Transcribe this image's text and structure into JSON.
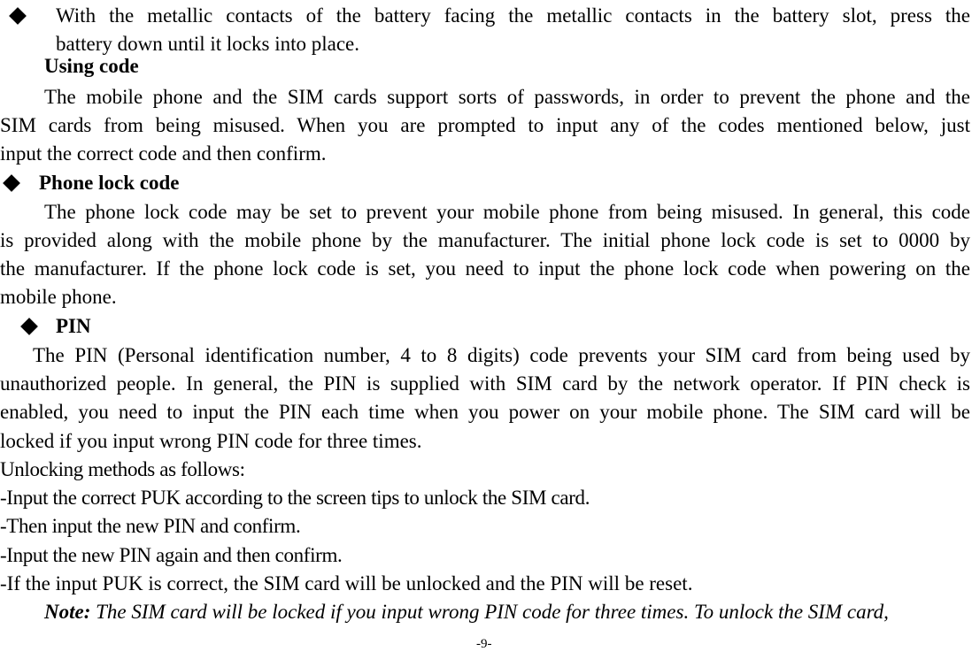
{
  "page": {
    "page_number": "-9-",
    "bullet_icon": "diamond-bullet-icon",
    "battery_step": {
      "line1": "With the metallic contacts of the battery facing the metallic contacts in the battery slot, press the",
      "line2": "battery down until it locks into place."
    },
    "using_code": {
      "heading": "Using code",
      "lines": [
        "The mobile phone and the SIM cards support sorts of passwords, in order to prevent the phone and the",
        "SIM cards from being misused. When you are prompted to input any of the codes mentioned below, just",
        "input the correct code and then confirm."
      ]
    },
    "phone_lock_code": {
      "heading": "Phone lock code",
      "lines": [
        "The phone lock code may be set to prevent your mobile phone from being misused. In general, this code",
        "is provided along with the mobile phone by the manufacturer. The initial phone lock code is set to 0000 by",
        "the manufacturer. If the phone lock code is set, you need to input the phone lock code when powering on the",
        "mobile phone."
      ]
    },
    "pin": {
      "heading": "PIN",
      "lines": [
        "The PIN (Personal identification number, 4 to 8 digits) code prevents your SIM card from being used by",
        "unauthorized people. In general, the PIN is supplied with SIM card by the network operator. If PIN check is",
        "enabled, you need to input the PIN each time when you power on your mobile phone. The SIM card will be",
        "locked if you input wrong PIN code for three times."
      ],
      "unlocking_intro": "Unlocking methods as follows:",
      "unlocking_steps": [
        "-Input the correct PUK according to the screen tips to unlock the SIM card.",
        "-Then input the new PIN and confirm.",
        "-Input the new PIN again and then confirm.",
        "-If the input PUK is correct, the SIM card will be unlocked and the PIN will be reset."
      ]
    },
    "note": {
      "label": "Note:",
      "text": "The SIM card will be locked if you input wrong PIN code for three times. To unlock the SIM card,"
    }
  }
}
